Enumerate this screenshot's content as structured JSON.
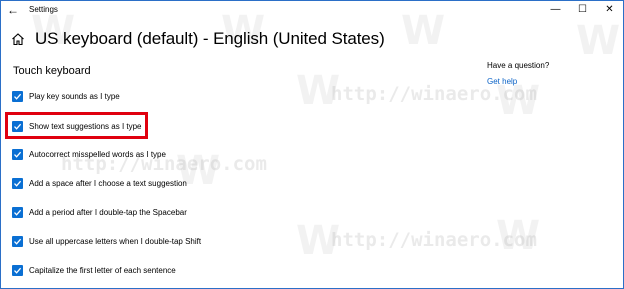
{
  "window": {
    "title": "Settings",
    "controls": {
      "minimize": "—",
      "maximize": "☐",
      "close": "✕"
    }
  },
  "header": {
    "title": "US keyboard (default) - English (United States)"
  },
  "section": {
    "title": "Touch keyboard"
  },
  "options": [
    {
      "label": "Play key sounds as I type",
      "checked": true
    },
    {
      "label": "Show text suggestions as I type",
      "checked": true,
      "highlighted": true
    },
    {
      "label": "Autocorrect misspelled words as I type",
      "checked": true
    },
    {
      "label": "Add a space after I choose a text suggestion",
      "checked": true
    },
    {
      "label": "Add a period after I double-tap the Spacebar",
      "checked": true
    },
    {
      "label": "Use all uppercase letters when I double-tap Shift",
      "checked": true
    },
    {
      "label": "Capitalize the first letter of each sentence",
      "checked": true
    }
  ],
  "help": {
    "question": "Have a question?",
    "link": "Get help"
  },
  "watermark": {
    "text": "http://winaero.com",
    "logo": "W"
  },
  "colors": {
    "accent": "#0a6fd3",
    "highlight": "#e0000e",
    "link": "#0a62c6",
    "border": "#2b6fc7"
  }
}
